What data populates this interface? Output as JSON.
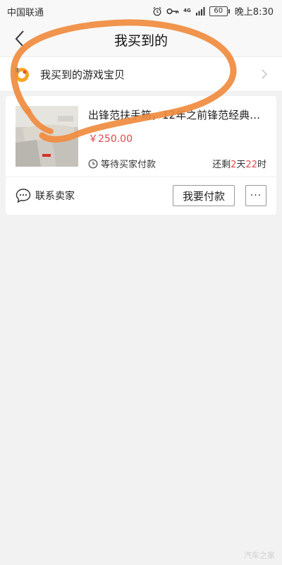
{
  "status_bar": {
    "carrier": "中国联通",
    "network": "4G",
    "battery": "60",
    "time": "晚上8:30"
  },
  "header": {
    "title": "我买到的"
  },
  "game_entry": {
    "label": "我买到的游戏宝贝"
  },
  "order": {
    "title": "出锋范扶手箱，12年之前锋范经典…",
    "price": "￥250.00",
    "status": "等待买家付款",
    "remaining_prefix": "还剩",
    "remaining_days": "2",
    "remaining_days_unit": "天",
    "remaining_hours": "22",
    "remaining_hours_unit": "时",
    "contact_label": "联系卖家",
    "pay_label": "我要付款",
    "more_label": "···"
  },
  "colors": {
    "price_red": "#e0484c",
    "annotation_orange": "#f08b3e"
  },
  "watermark": "汽车之家"
}
